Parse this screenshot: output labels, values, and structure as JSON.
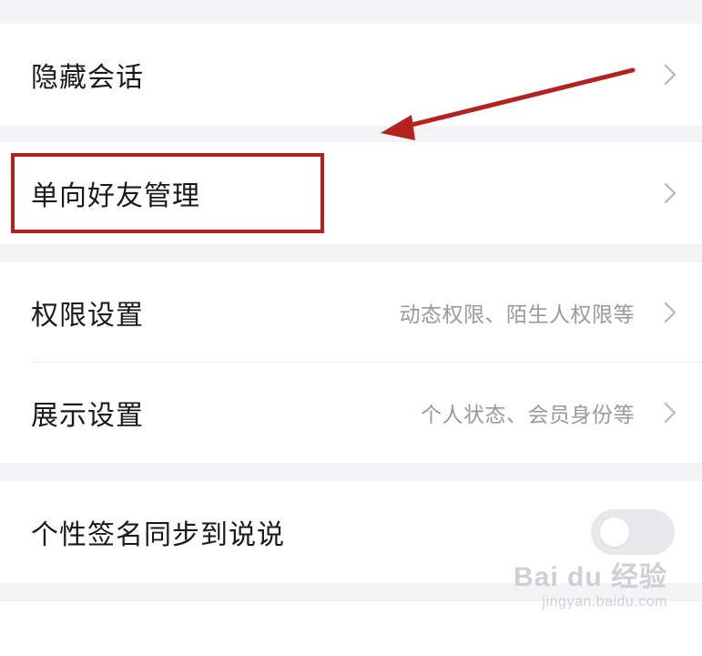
{
  "settings": {
    "hidden_chat": "隐藏会话",
    "one_way_friends": "单向好友管理",
    "permissions": {
      "label": "权限设置",
      "hint": "动态权限、陌生人权限等"
    },
    "display": {
      "label": "展示设置",
      "hint": "个人状态、会员身份等"
    },
    "signature_sync": {
      "label": "个性签名同步到说说",
      "enabled": false
    }
  },
  "annotation": {
    "highlight_color": "#b5221e"
  },
  "watermark": {
    "brand": "Bai du 经验",
    "url": "jingyan.baidu.com"
  },
  "icons": [
    "chevron-right-icon",
    "toggle-switch",
    "arrow-annotation"
  ]
}
